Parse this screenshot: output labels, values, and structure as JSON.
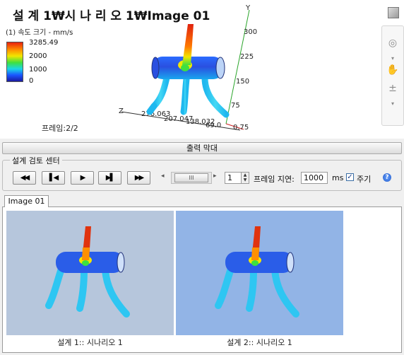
{
  "viewport": {
    "title": "설 계 1₩시 나 리 오 1₩Image 01",
    "legend_title": "(1) 속도 크기 - mm/s",
    "legend_ticks": [
      "3285.49",
      "2000",
      "1000",
      "0"
    ],
    "frame_label": "프레임:2/2",
    "axis_y_label": "Y",
    "axis_z_label": "Z",
    "y_ticks": [
      "300",
      "225",
      "150",
      "75"
    ],
    "z_ticks": [
      "276.063",
      "207.047",
      "138.032",
      "69.0",
      "0.75"
    ]
  },
  "toolbar": {
    "icons": [
      "orbit-icon",
      "chevron-down-icon",
      "pan-hand-icon",
      "zoom-icon",
      "chevron-down-icon"
    ]
  },
  "output_bar": {
    "label": "출력 막대"
  },
  "review_center": {
    "title": "설계 검토 센터",
    "buttons": {
      "first": "◀◀",
      "prev": "▌◀",
      "play": "▶",
      "next": "▶▌",
      "last": "▶▶"
    },
    "slider_thumb": "III",
    "frame_value": "1",
    "frame_delay_label": "프레임 지연:",
    "frame_delay_value": "1000",
    "unit_ms": "ms",
    "cycle_label": "주기",
    "cycle_checked": true
  },
  "tabs": [
    {
      "label": "Image 01",
      "active": true
    }
  ],
  "gallery": {
    "items": [
      {
        "caption": "설계 1:: 시나리오 1",
        "background": "#b6c6dc"
      },
      {
        "caption": "설계 2:: 시나리오 1",
        "background": "#92b4e6"
      }
    ]
  },
  "colors": {
    "accent": "#2a6bd8",
    "legend_high": "#e8220f",
    "legend_low": "#1a1aa0"
  }
}
